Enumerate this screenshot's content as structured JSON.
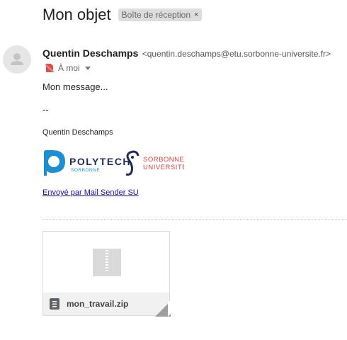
{
  "subject": "Mon objet",
  "label_chip": {
    "text": "Boîte de réception",
    "remove": "×"
  },
  "sender": {
    "name": "Quentin Deschamps",
    "email": "<quentin.deschamps@etu.sorbonne-universite.fr>"
  },
  "recipient": {
    "text": "À moi"
  },
  "body": {
    "message": "Mon message...",
    "separator": "--",
    "signature_name": "Quentin Deschamps"
  },
  "logos": {
    "polytech_main": "POLYTECH",
    "polytech_sub": "SORBONNE",
    "sorbonne_line1": "SORBONNE",
    "sorbonne_line2": "UNIVERSITÉ"
  },
  "sent_by": "Envoyé par Mail Sender SU",
  "attachment": {
    "file_name": "mon_travail.zip"
  },
  "colors": {
    "polytech_blue": "#1b8fd1",
    "sorbonne_red": "#d6403d",
    "sorbonne_navy": "#1f2a5c",
    "link": "#1a0dab"
  }
}
